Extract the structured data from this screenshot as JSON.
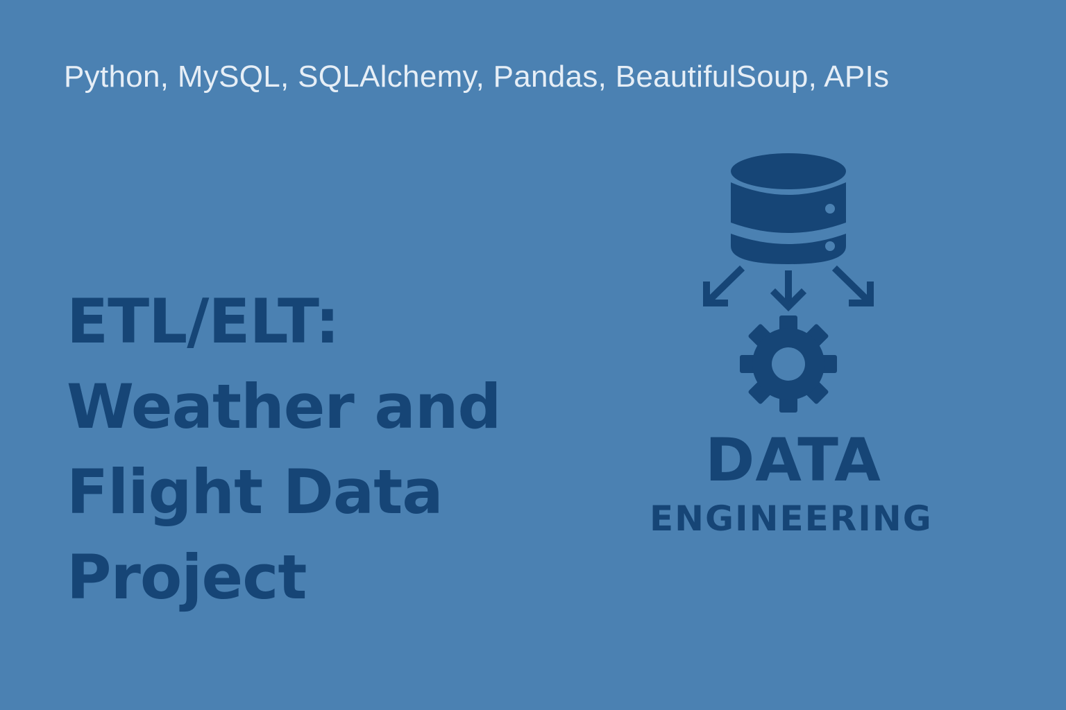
{
  "header": {
    "tech_stack": "Python, MySQL, SQLAlchemy, Pandas, BeautifulSoup, APIs"
  },
  "title": {
    "lines": [
      "ETL/ELT:",
      "Weather and",
      "Flight Data",
      "Project"
    ]
  },
  "graphic": {
    "icons": [
      "database-icon",
      "arrow-down-left-icon",
      "arrow-down-icon",
      "arrow-down-right-icon",
      "gear-icon"
    ],
    "label_main": "DATA",
    "label_sub": "ENGINEERING"
  },
  "colors": {
    "background": "#4b81b2",
    "primary": "#164576",
    "subtitle_text": "#e6eef6"
  }
}
